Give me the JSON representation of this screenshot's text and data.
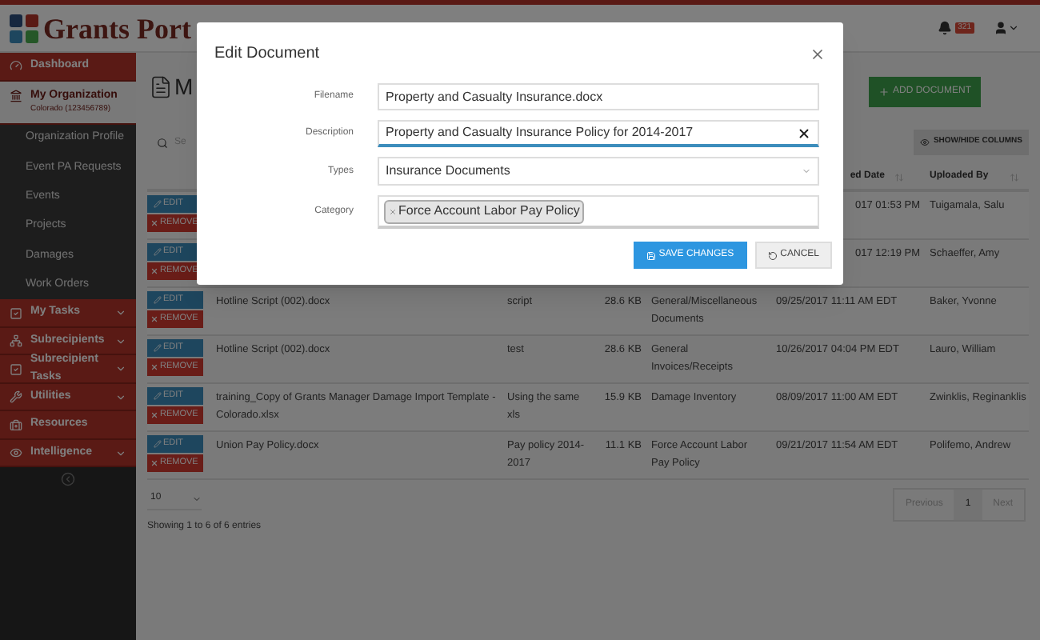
{
  "header": {
    "logo_text": "Grants Port",
    "notification_count": "321"
  },
  "sidebar": {
    "items": [
      {
        "kind": "link",
        "label": "Dashboard",
        "selected": false
      },
      {
        "kind": "section",
        "label": "My Organization",
        "sublabel": "Colorado (123456789)",
        "selected": true,
        "expanded": true,
        "children": [
          {
            "label": "Organization Profile"
          },
          {
            "label": "Event PA Requests"
          },
          {
            "label": "Events"
          },
          {
            "label": "Projects"
          },
          {
            "label": "Damages"
          },
          {
            "label": "Work Orders"
          }
        ]
      },
      {
        "kind": "group",
        "label": "My Tasks",
        "selected": false,
        "expanded": false
      },
      {
        "kind": "group",
        "label": "Subrecipients",
        "selected": false,
        "expanded": false
      },
      {
        "kind": "group",
        "label": "Subrecipient Tasks",
        "selected": false,
        "expanded": false
      },
      {
        "kind": "group",
        "label": "Utilities",
        "selected": false,
        "expanded": false
      },
      {
        "kind": "link",
        "label": "Resources",
        "selected": false
      },
      {
        "kind": "group",
        "label": "Intelligence",
        "selected": false,
        "expanded": false
      }
    ]
  },
  "page": {
    "title": "M",
    "add_button": "ADD DOCUMENT",
    "search_placeholder": "Se",
    "columns_button": "SHOW/HIDE COLUMNS"
  },
  "table": {
    "date_header": "ed Date",
    "uploader_header": "Uploaded By",
    "rows": [
      {
        "edit": "EDIT",
        "remove": "REMOVE",
        "date": "017 01:53 PM",
        "uploaded_by": "Tuigamala, Salu"
      },
      {
        "edit": "EDIT",
        "remove": "REMOVE",
        "date": "017 12:19 PM",
        "uploaded_by": "Schaeffer, Amy"
      },
      {
        "edit": "EDIT",
        "remove": "REMOVE",
        "filename": "Hotline Script (002).docx",
        "description": "script",
        "size": "28.6 KB",
        "category": "General/Miscellaneous Documents",
        "date": "09/25/2017 11:11 AM EDT",
        "uploaded_by": "Baker, Yvonne"
      },
      {
        "edit": "EDIT",
        "remove": "REMOVE",
        "filename": "Hotline Script (002).docx",
        "description": "test",
        "size": "28.6 KB",
        "category": "General Invoices/Receipts",
        "date": "10/26/2017 04:04 PM EDT",
        "uploaded_by": "Lauro, William"
      },
      {
        "edit": "EDIT",
        "remove": "REMOVE",
        "filename": "training_Copy of Grants Manager Damage Import Template - Colorado.xlsx",
        "description": "Using the same xls",
        "size": "15.9 KB",
        "category": "Damage Inventory",
        "date": "08/09/2017 11:00 AM EDT",
        "uploaded_by": "Zwinklis, Reginanklis"
      },
      {
        "edit": "EDIT",
        "remove": "REMOVE",
        "filename": "Union Pay Policy.docx",
        "description": "Pay policy 2014-2017",
        "size": "11.1 KB",
        "category": "Force Account Labor Pay Policy",
        "date": "09/21/2017 11:54 AM EDT",
        "uploaded_by": "Polifemo, Andrew"
      }
    ]
  },
  "footer": {
    "page_size": "10",
    "info": "Showing 1 to 6 of 6 entries",
    "previous": {
      "label": "Previous",
      "disabled": true
    },
    "pages": [
      {
        "label": "1",
        "selected": true
      }
    ],
    "next": {
      "label": "Next",
      "disabled": true
    }
  },
  "modal": {
    "title": "Edit Document",
    "fields": [
      {
        "kind": "text",
        "label": "Filename",
        "value": "Property and Casualty Insurance.docx",
        "focused": false
      },
      {
        "kind": "text",
        "label": "Description",
        "value": "Property and Casualty Insurance Policy for 2014-2017",
        "focused": true
      },
      {
        "kind": "select",
        "label": "Types",
        "value": "Insurance Documents",
        "focused": false
      },
      {
        "kind": "tags",
        "label": "Category",
        "tags": [
          "Force Account Labor Pay Policy"
        ],
        "focused": false
      }
    ],
    "save_button": "SAVE CHANGES",
    "cancel_button": "CANCEL"
  }
}
